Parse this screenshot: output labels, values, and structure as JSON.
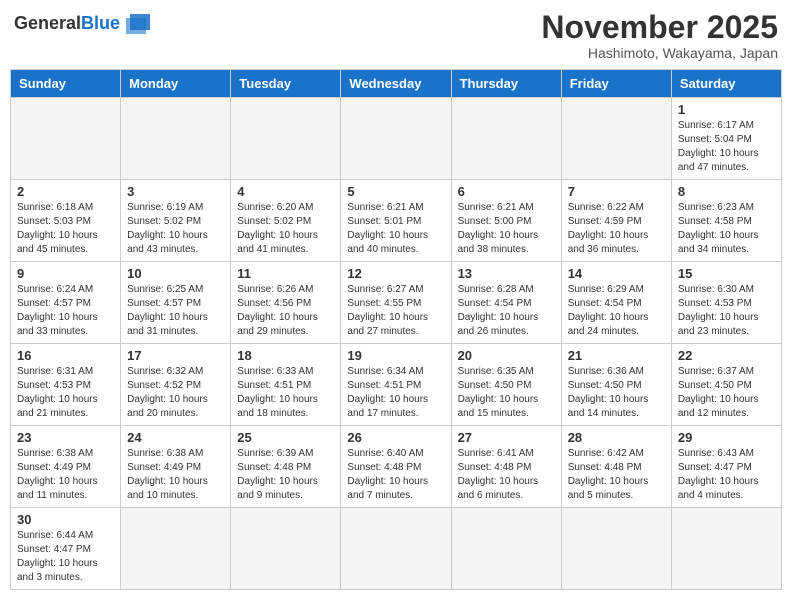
{
  "header": {
    "logo_general": "General",
    "logo_blue": "Blue",
    "month_title": "November 2025",
    "location": "Hashimoto, Wakayama, Japan"
  },
  "weekdays": [
    "Sunday",
    "Monday",
    "Tuesday",
    "Wednesday",
    "Thursday",
    "Friday",
    "Saturday"
  ],
  "weeks": [
    [
      {
        "day": "",
        "info": ""
      },
      {
        "day": "",
        "info": ""
      },
      {
        "day": "",
        "info": ""
      },
      {
        "day": "",
        "info": ""
      },
      {
        "day": "",
        "info": ""
      },
      {
        "day": "",
        "info": ""
      },
      {
        "day": "1",
        "info": "Sunrise: 6:17 AM\nSunset: 5:04 PM\nDaylight: 10 hours and 47 minutes."
      }
    ],
    [
      {
        "day": "2",
        "info": "Sunrise: 6:18 AM\nSunset: 5:03 PM\nDaylight: 10 hours and 45 minutes."
      },
      {
        "day": "3",
        "info": "Sunrise: 6:19 AM\nSunset: 5:02 PM\nDaylight: 10 hours and 43 minutes."
      },
      {
        "day": "4",
        "info": "Sunrise: 6:20 AM\nSunset: 5:02 PM\nDaylight: 10 hours and 41 minutes."
      },
      {
        "day": "5",
        "info": "Sunrise: 6:21 AM\nSunset: 5:01 PM\nDaylight: 10 hours and 40 minutes."
      },
      {
        "day": "6",
        "info": "Sunrise: 6:21 AM\nSunset: 5:00 PM\nDaylight: 10 hours and 38 minutes."
      },
      {
        "day": "7",
        "info": "Sunrise: 6:22 AM\nSunset: 4:59 PM\nDaylight: 10 hours and 36 minutes."
      },
      {
        "day": "8",
        "info": "Sunrise: 6:23 AM\nSunset: 4:58 PM\nDaylight: 10 hours and 34 minutes."
      }
    ],
    [
      {
        "day": "9",
        "info": "Sunrise: 6:24 AM\nSunset: 4:57 PM\nDaylight: 10 hours and 33 minutes."
      },
      {
        "day": "10",
        "info": "Sunrise: 6:25 AM\nSunset: 4:57 PM\nDaylight: 10 hours and 31 minutes."
      },
      {
        "day": "11",
        "info": "Sunrise: 6:26 AM\nSunset: 4:56 PM\nDaylight: 10 hours and 29 minutes."
      },
      {
        "day": "12",
        "info": "Sunrise: 6:27 AM\nSunset: 4:55 PM\nDaylight: 10 hours and 27 minutes."
      },
      {
        "day": "13",
        "info": "Sunrise: 6:28 AM\nSunset: 4:54 PM\nDaylight: 10 hours and 26 minutes."
      },
      {
        "day": "14",
        "info": "Sunrise: 6:29 AM\nSunset: 4:54 PM\nDaylight: 10 hours and 24 minutes."
      },
      {
        "day": "15",
        "info": "Sunrise: 6:30 AM\nSunset: 4:53 PM\nDaylight: 10 hours and 23 minutes."
      }
    ],
    [
      {
        "day": "16",
        "info": "Sunrise: 6:31 AM\nSunset: 4:53 PM\nDaylight: 10 hours and 21 minutes."
      },
      {
        "day": "17",
        "info": "Sunrise: 6:32 AM\nSunset: 4:52 PM\nDaylight: 10 hours and 20 minutes."
      },
      {
        "day": "18",
        "info": "Sunrise: 6:33 AM\nSunset: 4:51 PM\nDaylight: 10 hours and 18 minutes."
      },
      {
        "day": "19",
        "info": "Sunrise: 6:34 AM\nSunset: 4:51 PM\nDaylight: 10 hours and 17 minutes."
      },
      {
        "day": "20",
        "info": "Sunrise: 6:35 AM\nSunset: 4:50 PM\nDaylight: 10 hours and 15 minutes."
      },
      {
        "day": "21",
        "info": "Sunrise: 6:36 AM\nSunset: 4:50 PM\nDaylight: 10 hours and 14 minutes."
      },
      {
        "day": "22",
        "info": "Sunrise: 6:37 AM\nSunset: 4:50 PM\nDaylight: 10 hours and 12 minutes."
      }
    ],
    [
      {
        "day": "23",
        "info": "Sunrise: 6:38 AM\nSunset: 4:49 PM\nDaylight: 10 hours and 11 minutes."
      },
      {
        "day": "24",
        "info": "Sunrise: 6:38 AM\nSunset: 4:49 PM\nDaylight: 10 hours and 10 minutes."
      },
      {
        "day": "25",
        "info": "Sunrise: 6:39 AM\nSunset: 4:48 PM\nDaylight: 10 hours and 9 minutes."
      },
      {
        "day": "26",
        "info": "Sunrise: 6:40 AM\nSunset: 4:48 PM\nDaylight: 10 hours and 7 minutes."
      },
      {
        "day": "27",
        "info": "Sunrise: 6:41 AM\nSunset: 4:48 PM\nDaylight: 10 hours and 6 minutes."
      },
      {
        "day": "28",
        "info": "Sunrise: 6:42 AM\nSunset: 4:48 PM\nDaylight: 10 hours and 5 minutes."
      },
      {
        "day": "29",
        "info": "Sunrise: 6:43 AM\nSunset: 4:47 PM\nDaylight: 10 hours and 4 minutes."
      }
    ],
    [
      {
        "day": "30",
        "info": "Sunrise: 6:44 AM\nSunset: 4:47 PM\nDaylight: 10 hours and 3 minutes."
      },
      {
        "day": "",
        "info": ""
      },
      {
        "day": "",
        "info": ""
      },
      {
        "day": "",
        "info": ""
      },
      {
        "day": "",
        "info": ""
      },
      {
        "day": "",
        "info": ""
      },
      {
        "day": "",
        "info": ""
      }
    ]
  ]
}
